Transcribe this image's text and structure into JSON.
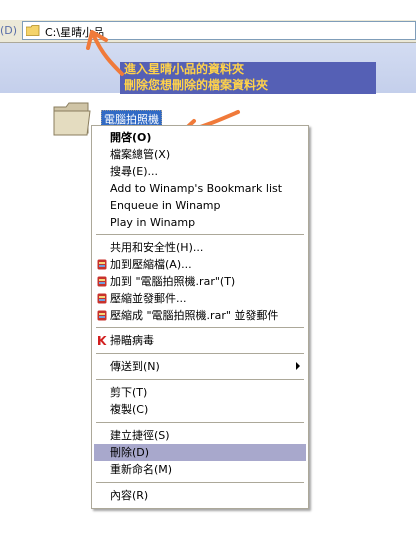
{
  "address": {
    "menu_fragment": "(D)",
    "path": "C:\\星晴小品"
  },
  "annotation": {
    "line1": "進入星晴小品的資料夾",
    "line2": "刪除您想刪除的檔案資料夾",
    "color_bg": "#5560b5",
    "color_text": "#ffd24a",
    "arrow_color": "#f07a3a"
  },
  "folder": {
    "name": "電腦拍照機"
  },
  "context_menu": {
    "items": [
      {
        "label": "開啓(O)"
      },
      {
        "label": "檔案總管(X)"
      },
      {
        "label": "搜尋(E)..."
      },
      {
        "label": "Add to Winamp's Bookmark list"
      },
      {
        "label": "Enqueue in Winamp"
      },
      {
        "label": "Play in Winamp"
      },
      {
        "label": "共用和安全性(H)..."
      },
      {
        "label": "加到壓縮檔(A)..."
      },
      {
        "label": "加到 \"電腦拍照機.rar\"(T)"
      },
      {
        "label": "壓縮並發郵件..."
      },
      {
        "label": "壓縮成 \"電腦拍照機.rar\" 並發郵件"
      },
      {
        "label": "掃瞄病毒"
      },
      {
        "label": "傳送到(N)"
      },
      {
        "label": "剪下(T)"
      },
      {
        "label": "複製(C)"
      },
      {
        "label": "建立捷徑(S)"
      },
      {
        "label": "刪除(D)"
      },
      {
        "label": "重新命名(M)"
      },
      {
        "label": "內容(R)"
      }
    ],
    "highlighted": "刪除(D)",
    "highlight_color": "#a8a8cc"
  }
}
